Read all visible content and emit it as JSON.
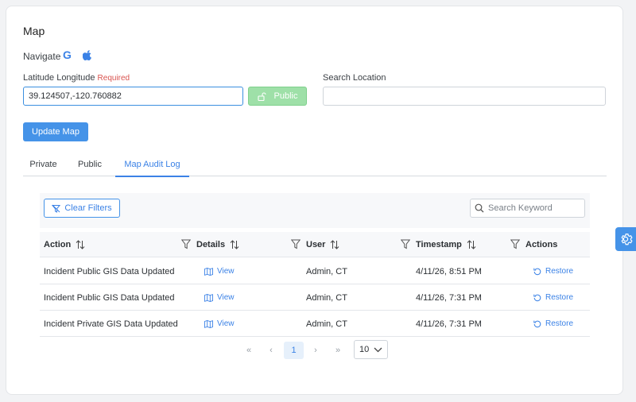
{
  "map": {
    "title": "Map",
    "navigate_label": "Navigate",
    "google_glyph": "G",
    "latlng_label": "Latitude Longitude",
    "required_label": "Required",
    "latlng_value": "39.124507,-120.760882",
    "public_button": "Public",
    "search_location_label": "Search Location",
    "search_location_value": "",
    "update_button": "Update Map"
  },
  "tabs": [
    {
      "label": "Private",
      "active": false
    },
    {
      "label": "Public",
      "active": false
    },
    {
      "label": "Map Audit Log",
      "active": true
    }
  ],
  "audit": {
    "clear_filters": "Clear Filters",
    "search_placeholder": "Search Keyword",
    "columns": {
      "action": "Action",
      "details": "Details",
      "user": "User",
      "timestamp": "Timestamp",
      "actions": "Actions"
    },
    "rows": [
      {
        "action": "Incident Public GIS Data Updated",
        "details": "View",
        "user": "Admin, CT",
        "timestamp": "4/11/26, 8:51 PM",
        "restore": "Restore"
      },
      {
        "action": "Incident Public GIS Data Updated",
        "details": "View",
        "user": "Admin, CT",
        "timestamp": "4/11/26, 7:31 PM",
        "restore": "Restore"
      },
      {
        "action": "Incident Private GIS Data Updated",
        "details": "View",
        "user": "Admin, CT",
        "timestamp": "4/11/26, 7:31 PM",
        "restore": "Restore"
      }
    ],
    "pagination": {
      "first": "«",
      "prev": "‹",
      "current_page": "1",
      "next": "›",
      "last": "»",
      "page_size": "10"
    }
  },
  "icons": {
    "google": "google-icon",
    "apple": "apple-icon",
    "lock": "unlock-icon",
    "filter": "filter-icon",
    "search": "search-icon",
    "sort": "sort-icon",
    "map": "map-icon",
    "restore": "restore-icon",
    "gear": "gear-icon",
    "chevron": "chevron-down-icon"
  },
  "colors": {
    "primary": "#4593e8",
    "public_button": "#9ee0a8",
    "required": "#d9534f"
  }
}
